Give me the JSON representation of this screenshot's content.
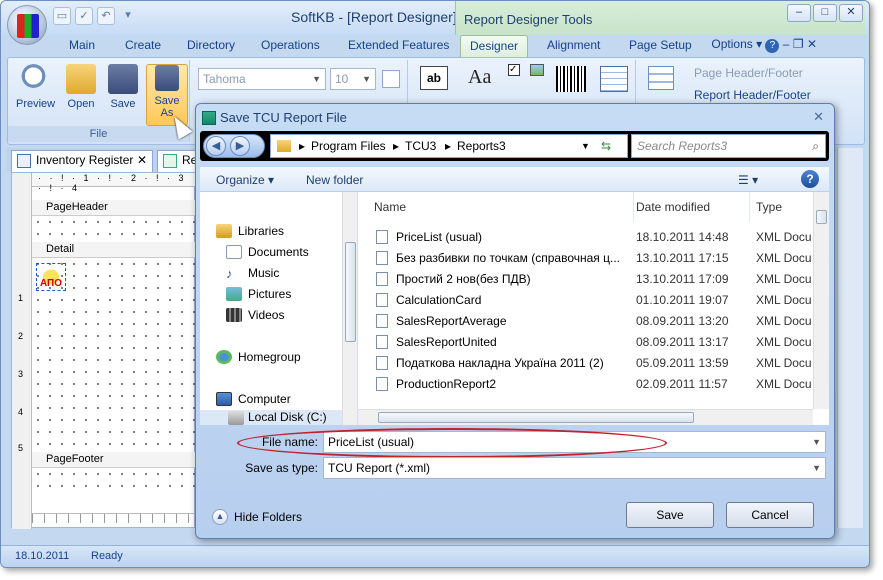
{
  "app": {
    "title": "SoftKB - [Report Designer]",
    "context_title": "Report Designer Tools"
  },
  "tabs": [
    "Main",
    "Create",
    "Directory",
    "Operations",
    "Extended Features",
    "Designer",
    "Alignment",
    "Page Setup"
  ],
  "options_label": "Options",
  "ribbon": {
    "file_group": {
      "label": "File",
      "buttons": [
        "Preview",
        "Open",
        "Save",
        "Save As"
      ]
    },
    "font_name": "Tahoma",
    "font_size": "10",
    "headers": {
      "page_header_footer": "Page Header/Footer",
      "report_header_footer": "Report Header/Footer"
    }
  },
  "doc_tabs": [
    "Inventory Register",
    "Re"
  ],
  "designer": {
    "bands": [
      "PageHeader",
      "Detail",
      "PageFooter"
    ],
    "ruler_marks": "1 2 3 4",
    "vruler_marks": [
      "1",
      "2",
      "3",
      "4",
      "5"
    ]
  },
  "status": {
    "date": "18.10.2011",
    "state": "Ready"
  },
  "dialog": {
    "title": "Save TCU Report File",
    "breadcrumb": [
      "Program Files",
      "TCU3",
      "Reports3"
    ],
    "search_placeholder": "Search Reports3",
    "commands": {
      "organize": "Organize",
      "new_folder": "New folder"
    },
    "nav_items": [
      "Libraries",
      "Documents",
      "Music",
      "Pictures",
      "Videos",
      "Homegroup",
      "Computer",
      "Local Disk (C:)"
    ],
    "columns": [
      "Name",
      "Date modified",
      "Type"
    ],
    "files": [
      {
        "name": "PriceList (usual)",
        "date": "18.10.2011 14:48",
        "type": "XML Docu"
      },
      {
        "name": "Без разбивки по точкам (справочная ц...",
        "date": "13.10.2011 17:15",
        "type": "XML Docu"
      },
      {
        "name": "Простий 2 нов(без ПДВ)",
        "date": "13.10.2011 17:09",
        "type": "XML Docu"
      },
      {
        "name": "CalculationCard",
        "date": "01.10.2011 19:07",
        "type": "XML Docu"
      },
      {
        "name": "SalesReportAverage",
        "date": "08.09.2011 13:20",
        "type": "XML Docu"
      },
      {
        "name": "SalesReportUnited",
        "date": "08.09.2011 13:17",
        "type": "XML Docu"
      },
      {
        "name": "Податкова накладна Україна 2011 (2)",
        "date": "05.09.2011 13:59",
        "type": "XML Docu"
      },
      {
        "name": "ProductionReport2",
        "date": "02.09.2011 11:57",
        "type": "XML Docu"
      }
    ],
    "file_name_label": "File name:",
    "file_name_value": "PriceList (usual)",
    "save_type_label": "Save as type:",
    "save_type_value": "TCU Report (*.xml)",
    "hide_folders": "Hide Folders",
    "save": "Save",
    "cancel": "Cancel"
  }
}
